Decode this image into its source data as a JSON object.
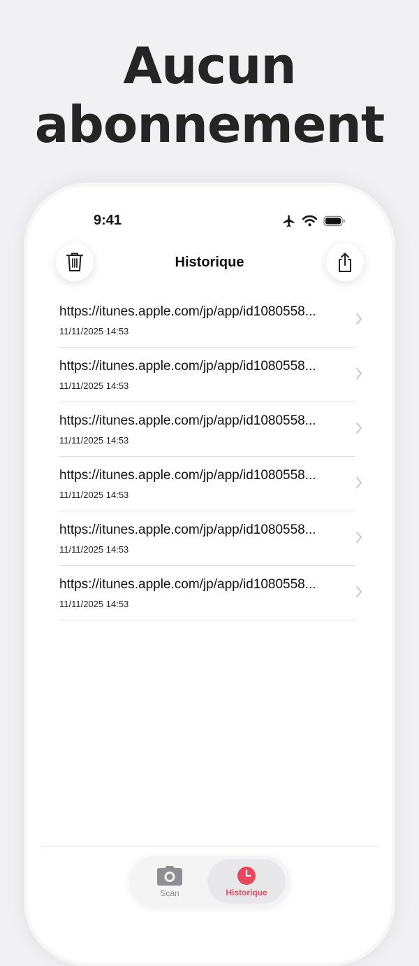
{
  "headline": {
    "line1": "Aucun",
    "line2": "abonnement"
  },
  "status_bar": {
    "time": "9:41",
    "icons": [
      "airplane-icon",
      "wifi-icon",
      "battery-icon"
    ]
  },
  "nav": {
    "title": "Historique",
    "left_icon": "trash-icon",
    "right_icon": "share-icon"
  },
  "history": [
    {
      "url": "https://itunes.apple.com/jp/app/id1080558...",
      "date": "11/11/2025 14:53"
    },
    {
      "url": "https://itunes.apple.com/jp/app/id1080558...",
      "date": "11/11/2025 14:53"
    },
    {
      "url": "https://itunes.apple.com/jp/app/id1080558...",
      "date": "11/11/2025 14:53"
    },
    {
      "url": "https://itunes.apple.com/jp/app/id1080558...",
      "date": "11/11/2025 14:53"
    },
    {
      "url": "https://itunes.apple.com/jp/app/id1080558...",
      "date": "11/11/2025 14:53"
    },
    {
      "url": "https://itunes.apple.com/jp/app/id1080558...",
      "date": "11/11/2025 14:53"
    }
  ],
  "tab_bar": {
    "tabs": [
      {
        "label": "Scan",
        "icon": "camera-icon",
        "active": false
      },
      {
        "label": "Historique",
        "icon": "clock-icon",
        "active": true
      }
    ]
  },
  "colors": {
    "accent": "#e8475b",
    "background": "#f1f1f3",
    "text": "#111111",
    "muted": "#8e8e93"
  }
}
